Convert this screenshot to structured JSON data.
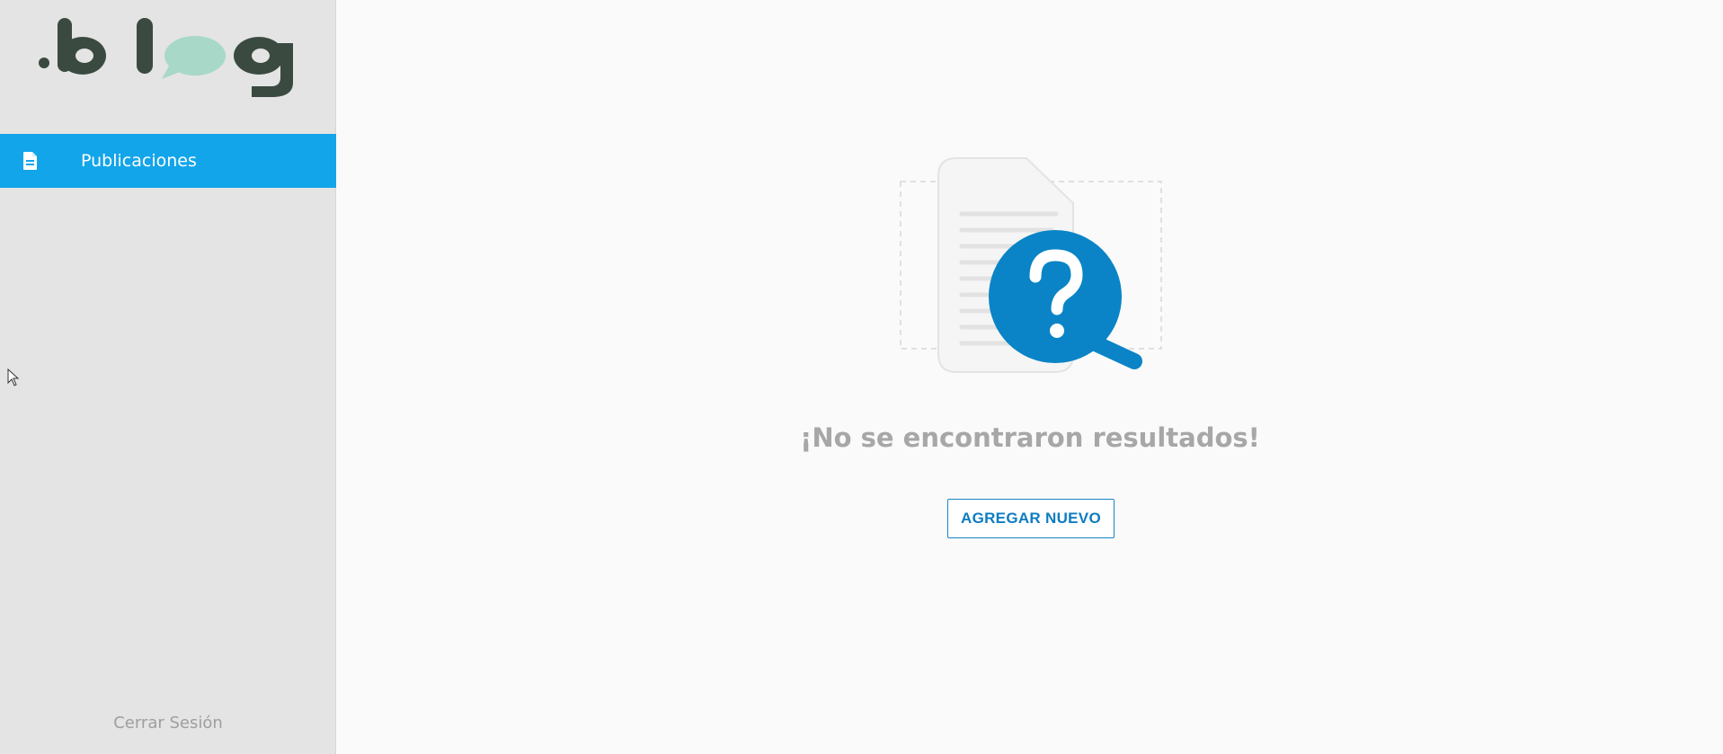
{
  "brand": {
    "logo_text": ".blog",
    "dark_color": "#3a4a40",
    "bubble_color": "#a8d8c8"
  },
  "sidebar": {
    "items": [
      {
        "label": "Publicaciones",
        "icon": "document-icon",
        "active": true
      }
    ],
    "logout_label": "Cerrar Sesión"
  },
  "main": {
    "empty_state": {
      "title": "¡No se encontraron resultados!",
      "button_label": "AGREGAR NUEVO",
      "icon": "question-search-icon"
    }
  },
  "colors": {
    "accent": "#12a5ea",
    "primary": "#0a84c6",
    "muted_text": "#a7a7a7"
  }
}
